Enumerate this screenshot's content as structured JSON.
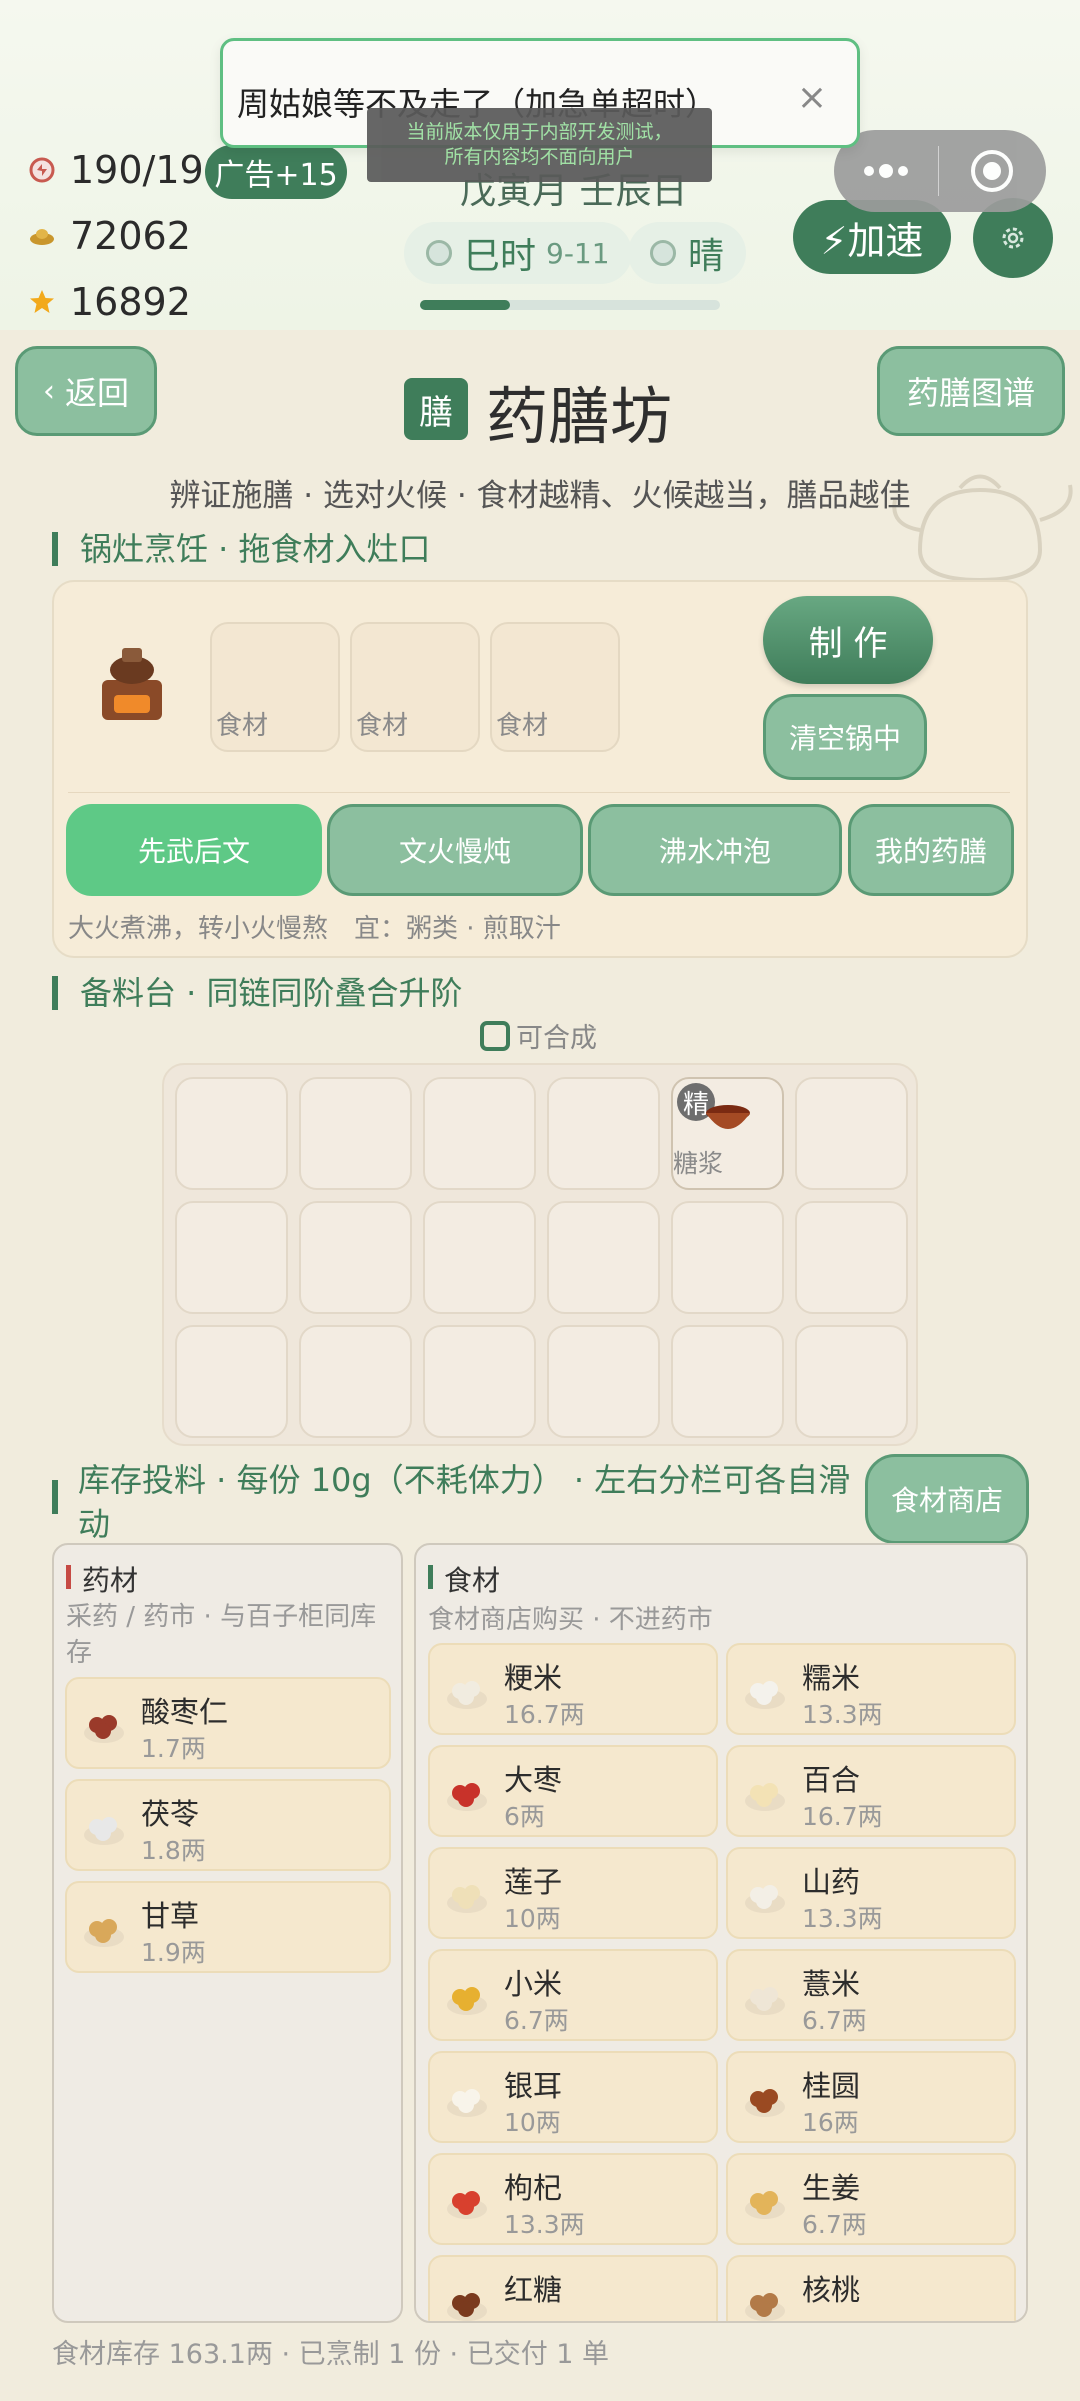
{
  "status": {
    "stamina": "190/190",
    "gold": "72062",
    "stars": "16892",
    "ad_label": "广告+15",
    "date": "戊寅月 壬辰日",
    "time_name": "巳时",
    "time_range": "9-11",
    "weather": "晴",
    "day_progress": 0.3,
    "speed_label": "⚡加速"
  },
  "toast": {
    "text": "周姑娘等不及走了（加急单超时）",
    "close": "×"
  },
  "dev_notice": {
    "line1": "当前版本仅用于内部开发测试，",
    "line2": "所有内容均不面向用户"
  },
  "page": {
    "back_label": "返回",
    "atlas_label": "药膳图谱",
    "badge": "膳",
    "title": "药膳坊",
    "subtitle": "辨证施膳 · 选对火候 · 食材越精、火候越当，膳品越佳"
  },
  "stove": {
    "section_title": "锅灶烹饪 · 拖食材入灶口",
    "slots": [
      "食材",
      "食材",
      "食材"
    ],
    "make_label": "制 作",
    "clear_label": "清空锅中",
    "heat_modes": [
      {
        "label": "先武后文",
        "active": true
      },
      {
        "label": "文火慢炖",
        "active": false
      },
      {
        "label": "沸水冲泡",
        "active": false
      },
      {
        "label": "我的药膳",
        "active": false
      }
    ],
    "hint": "大火煮沸，转小火慢熬　宜：粥类 · 煎取汁"
  },
  "prep": {
    "section_title": "备料台 · 同链同阶叠合升阶",
    "legend": "可合成",
    "filled_cell": {
      "badge": "精",
      "label": "糖浆"
    }
  },
  "inventory": {
    "section_title_line1": "库存投料 · 每份 10g（不耗体力） · 左右分栏可各自滑",
    "section_title_line2": "动",
    "shop_label": "食材商店",
    "herbs": {
      "title": "药材",
      "desc_line1": "采药 / 药市 · 与百子柜同库",
      "desc_line2": "存",
      "items": [
        {
          "name": "酸枣仁",
          "amount": "1.7两",
          "color": "#9a3a2a"
        },
        {
          "name": "茯苓",
          "amount": "1.8两",
          "color": "#e8e8e8"
        },
        {
          "name": "甘草",
          "amount": "1.9两",
          "color": "#d9a85a"
        }
      ]
    },
    "foods": {
      "title": "食材",
      "desc": "食材商店购买 · 不进药市",
      "items": [
        {
          "name": "粳米",
          "amount": "16.7两",
          "color": "#f1ece0"
        },
        {
          "name": "糯米",
          "amount": "13.3两",
          "color": "#f4f2ec"
        },
        {
          "name": "大枣",
          "amount": "6两",
          "color": "#c8322a"
        },
        {
          "name": "百合",
          "amount": "16.7两",
          "color": "#f3e2b5"
        },
        {
          "name": "莲子",
          "amount": "10两",
          "color": "#efe0b8"
        },
        {
          "name": "山药",
          "amount": "13.3两",
          "color": "#f3efe6"
        },
        {
          "name": "小米",
          "amount": "6.7两",
          "color": "#e7b030"
        },
        {
          "name": "薏米",
          "amount": "6.7两",
          "color": "#efe6d6"
        },
        {
          "name": "银耳",
          "amount": "10两",
          "color": "#f8f4ea"
        },
        {
          "name": "桂圆",
          "amount": "16两",
          "color": "#9a4a22"
        },
        {
          "name": "枸杞",
          "amount": "13.3两",
          "color": "#d8402e"
        },
        {
          "name": "生姜",
          "amount": "6.7两",
          "color": "#e3b45a"
        },
        {
          "name": "红糖",
          "amount": "",
          "color": "#7a3a1e"
        },
        {
          "name": "核桃",
          "amount": "",
          "color": "#b27a48"
        }
      ]
    }
  },
  "footer": "食材库存 163.1两 · 已烹制 1 份 · 已交付 1 单"
}
